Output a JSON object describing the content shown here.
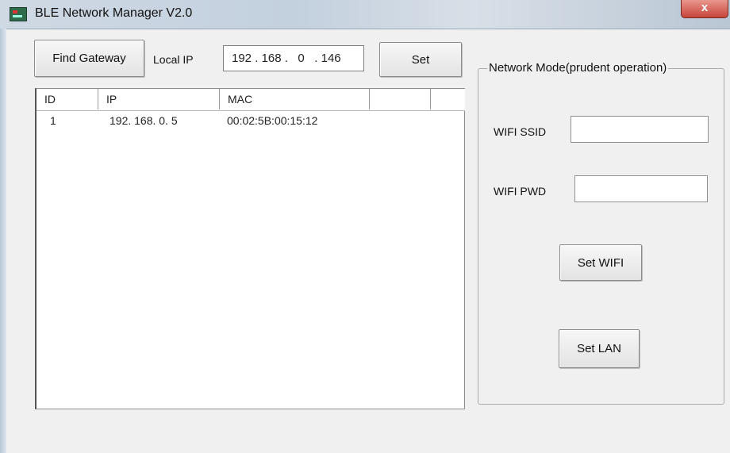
{
  "window": {
    "title": "BLE Network Manager V2.0",
    "close_glyph": "x"
  },
  "toolbar": {
    "find_gateway_label": "Find Gateway",
    "local_ip_label": "Local IP",
    "local_ip": {
      "o1": "192",
      "o2": "168",
      "o3": "0",
      "o4": "146"
    },
    "set_label": "Set"
  },
  "device_list": {
    "columns": [
      "ID",
      "IP",
      "MAC",
      "",
      ""
    ],
    "rows": [
      {
        "id": "1",
        "ip": "192. 168. 0. 5",
        "mac": "00:02:5B:00:15:12"
      }
    ]
  },
  "network_mode": {
    "title": "Network Mode(prudent operation)",
    "ssid_label": "WIFI SSID",
    "ssid_value": "",
    "pwd_label": "WIFI PWD",
    "pwd_value": "",
    "set_wifi_label": "Set WIFI",
    "set_lan_label": "Set LAN"
  },
  "icons": {
    "app": "app-icon",
    "close": "close-icon"
  }
}
